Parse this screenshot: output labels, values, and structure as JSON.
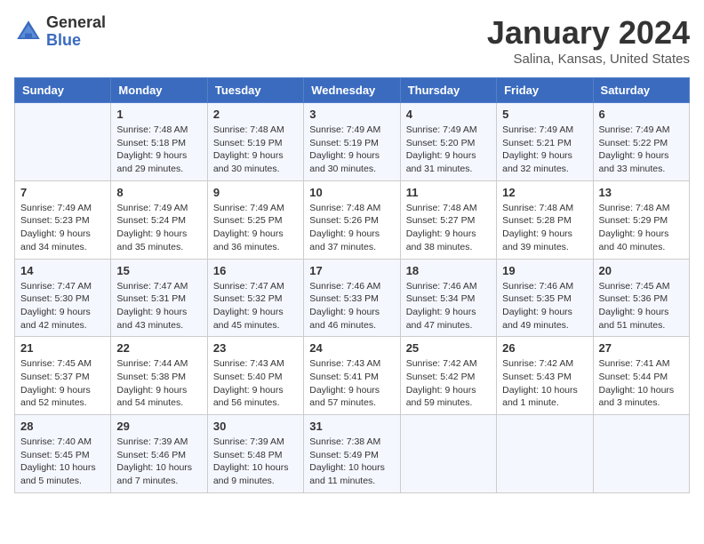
{
  "header": {
    "logo_general": "General",
    "logo_blue": "Blue",
    "title": "January 2024",
    "location": "Salina, Kansas, United States"
  },
  "weekdays": [
    "Sunday",
    "Monday",
    "Tuesday",
    "Wednesday",
    "Thursday",
    "Friday",
    "Saturday"
  ],
  "weeks": [
    [
      {
        "day": "",
        "info": ""
      },
      {
        "day": "1",
        "info": "Sunrise: 7:48 AM\nSunset: 5:18 PM\nDaylight: 9 hours\nand 29 minutes."
      },
      {
        "day": "2",
        "info": "Sunrise: 7:48 AM\nSunset: 5:19 PM\nDaylight: 9 hours\nand 30 minutes."
      },
      {
        "day": "3",
        "info": "Sunrise: 7:49 AM\nSunset: 5:19 PM\nDaylight: 9 hours\nand 30 minutes."
      },
      {
        "day": "4",
        "info": "Sunrise: 7:49 AM\nSunset: 5:20 PM\nDaylight: 9 hours\nand 31 minutes."
      },
      {
        "day": "5",
        "info": "Sunrise: 7:49 AM\nSunset: 5:21 PM\nDaylight: 9 hours\nand 32 minutes."
      },
      {
        "day": "6",
        "info": "Sunrise: 7:49 AM\nSunset: 5:22 PM\nDaylight: 9 hours\nand 33 minutes."
      }
    ],
    [
      {
        "day": "7",
        "info": "Sunrise: 7:49 AM\nSunset: 5:23 PM\nDaylight: 9 hours\nand 34 minutes."
      },
      {
        "day": "8",
        "info": "Sunrise: 7:49 AM\nSunset: 5:24 PM\nDaylight: 9 hours\nand 35 minutes."
      },
      {
        "day": "9",
        "info": "Sunrise: 7:49 AM\nSunset: 5:25 PM\nDaylight: 9 hours\nand 36 minutes."
      },
      {
        "day": "10",
        "info": "Sunrise: 7:48 AM\nSunset: 5:26 PM\nDaylight: 9 hours\nand 37 minutes."
      },
      {
        "day": "11",
        "info": "Sunrise: 7:48 AM\nSunset: 5:27 PM\nDaylight: 9 hours\nand 38 minutes."
      },
      {
        "day": "12",
        "info": "Sunrise: 7:48 AM\nSunset: 5:28 PM\nDaylight: 9 hours\nand 39 minutes."
      },
      {
        "day": "13",
        "info": "Sunrise: 7:48 AM\nSunset: 5:29 PM\nDaylight: 9 hours\nand 40 minutes."
      }
    ],
    [
      {
        "day": "14",
        "info": "Sunrise: 7:47 AM\nSunset: 5:30 PM\nDaylight: 9 hours\nand 42 minutes."
      },
      {
        "day": "15",
        "info": "Sunrise: 7:47 AM\nSunset: 5:31 PM\nDaylight: 9 hours\nand 43 minutes."
      },
      {
        "day": "16",
        "info": "Sunrise: 7:47 AM\nSunset: 5:32 PM\nDaylight: 9 hours\nand 45 minutes."
      },
      {
        "day": "17",
        "info": "Sunrise: 7:46 AM\nSunset: 5:33 PM\nDaylight: 9 hours\nand 46 minutes."
      },
      {
        "day": "18",
        "info": "Sunrise: 7:46 AM\nSunset: 5:34 PM\nDaylight: 9 hours\nand 47 minutes."
      },
      {
        "day": "19",
        "info": "Sunrise: 7:46 AM\nSunset: 5:35 PM\nDaylight: 9 hours\nand 49 minutes."
      },
      {
        "day": "20",
        "info": "Sunrise: 7:45 AM\nSunset: 5:36 PM\nDaylight: 9 hours\nand 51 minutes."
      }
    ],
    [
      {
        "day": "21",
        "info": "Sunrise: 7:45 AM\nSunset: 5:37 PM\nDaylight: 9 hours\nand 52 minutes."
      },
      {
        "day": "22",
        "info": "Sunrise: 7:44 AM\nSunset: 5:38 PM\nDaylight: 9 hours\nand 54 minutes."
      },
      {
        "day": "23",
        "info": "Sunrise: 7:43 AM\nSunset: 5:40 PM\nDaylight: 9 hours\nand 56 minutes."
      },
      {
        "day": "24",
        "info": "Sunrise: 7:43 AM\nSunset: 5:41 PM\nDaylight: 9 hours\nand 57 minutes."
      },
      {
        "day": "25",
        "info": "Sunrise: 7:42 AM\nSunset: 5:42 PM\nDaylight: 9 hours\nand 59 minutes."
      },
      {
        "day": "26",
        "info": "Sunrise: 7:42 AM\nSunset: 5:43 PM\nDaylight: 10 hours\nand 1 minute."
      },
      {
        "day": "27",
        "info": "Sunrise: 7:41 AM\nSunset: 5:44 PM\nDaylight: 10 hours\nand 3 minutes."
      }
    ],
    [
      {
        "day": "28",
        "info": "Sunrise: 7:40 AM\nSunset: 5:45 PM\nDaylight: 10 hours\nand 5 minutes."
      },
      {
        "day": "29",
        "info": "Sunrise: 7:39 AM\nSunset: 5:46 PM\nDaylight: 10 hours\nand 7 minutes."
      },
      {
        "day": "30",
        "info": "Sunrise: 7:39 AM\nSunset: 5:48 PM\nDaylight: 10 hours\nand 9 minutes."
      },
      {
        "day": "31",
        "info": "Sunrise: 7:38 AM\nSunset: 5:49 PM\nDaylight: 10 hours\nand 11 minutes."
      },
      {
        "day": "",
        "info": ""
      },
      {
        "day": "",
        "info": ""
      },
      {
        "day": "",
        "info": ""
      }
    ]
  ]
}
